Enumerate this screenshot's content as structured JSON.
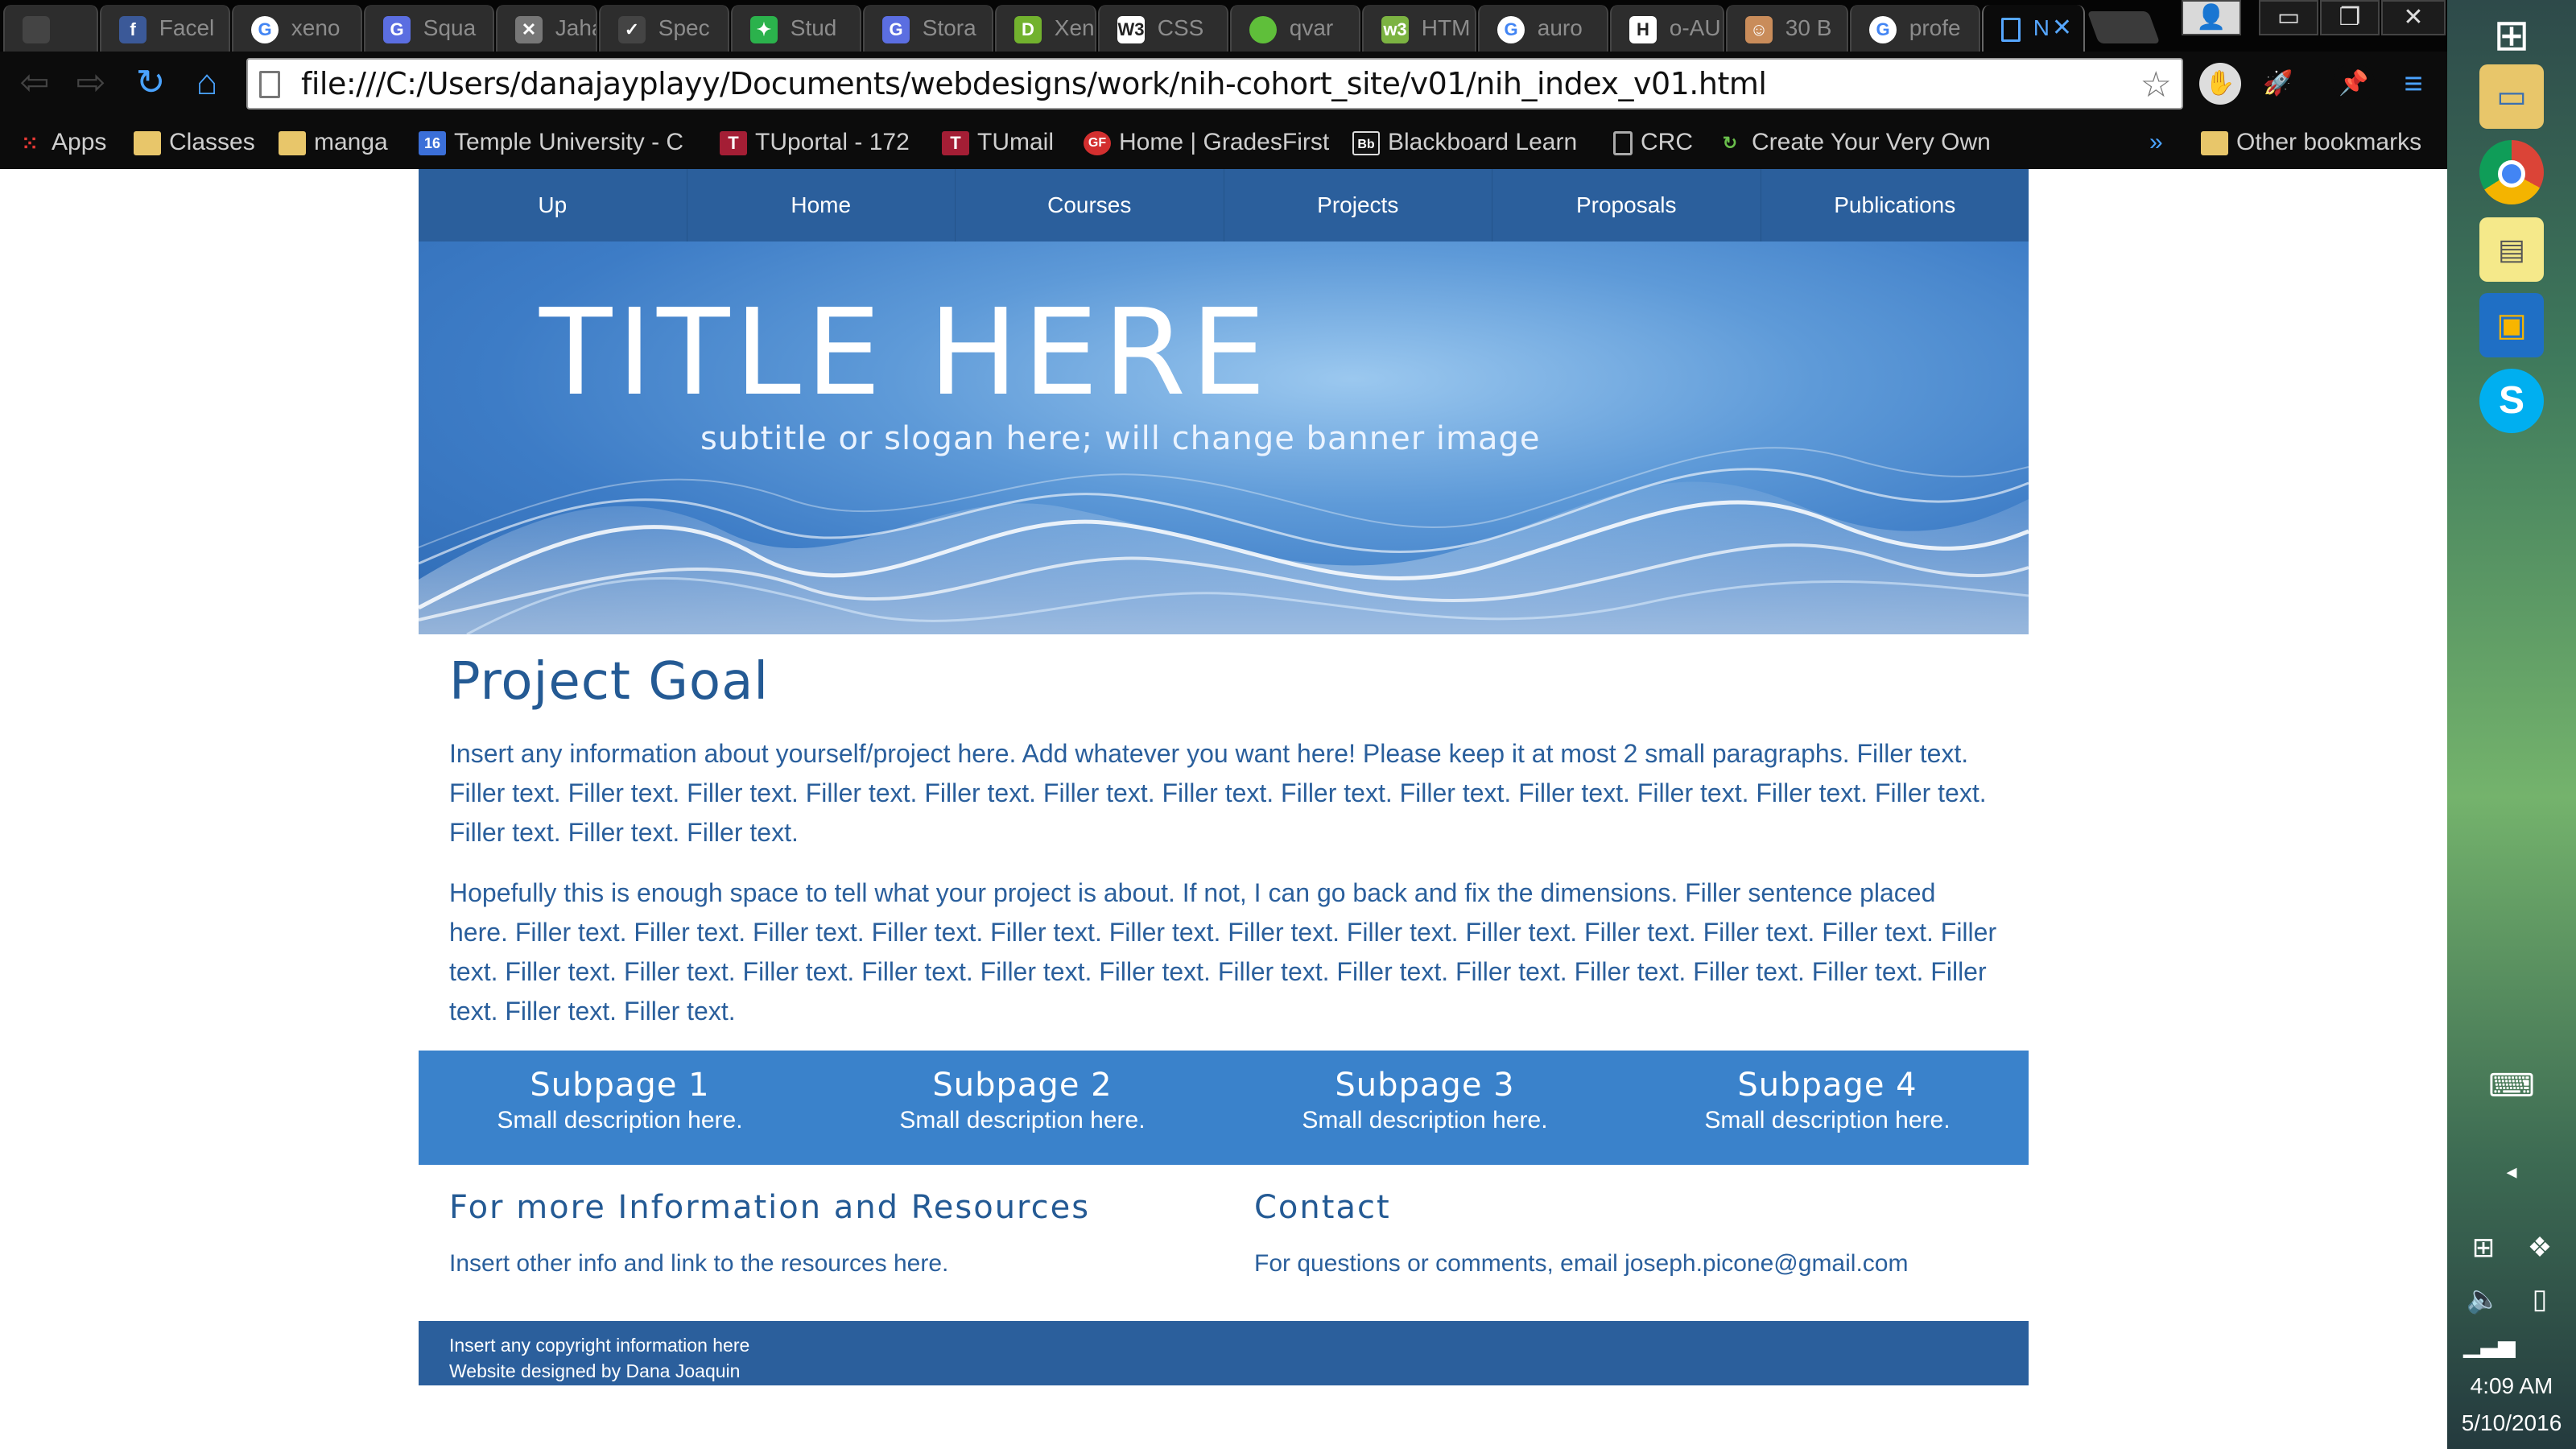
{
  "browser": {
    "tabs": [
      {
        "label": "",
        "icon": "blank-page-icon",
        "color": "#555555"
      },
      {
        "label": "Facel",
        "icon": "facebook-icon",
        "color": "#3b5998"
      },
      {
        "label": "xeno",
        "icon": "google-icon",
        "color": "#4285f4"
      },
      {
        "label": "Squa",
        "icon": "squarespace-icon",
        "color": "#5b6ee1"
      },
      {
        "label": "Jahar",
        "icon": "x-icon",
        "color": "#777777"
      },
      {
        "label": "Spec",
        "icon": "check-icon",
        "color": "#444444"
      },
      {
        "label": "Stud",
        "icon": "puzzle-icon",
        "color": "#2bb24c"
      },
      {
        "label": "Stora",
        "icon": "squarespace-icon",
        "color": "#5b6ee1"
      },
      {
        "label": "Xeno",
        "icon": "d-icon",
        "color": "#72b22e"
      },
      {
        "label": "CSS",
        "icon": "w3-icon",
        "color": "#ffffff"
      },
      {
        "label": "qvar",
        "icon": "circle-icon",
        "color": "#5fbf3a"
      },
      {
        "label": "HTM",
        "icon": "w3-icon",
        "color": "#7cb342"
      },
      {
        "label": "auro",
        "icon": "google-icon",
        "color": "#4285f4"
      },
      {
        "label": "o-AU",
        "icon": "h-icon",
        "color": "#ffffff"
      },
      {
        "label": "30 B",
        "icon": "avatar-icon",
        "color": "#c98c5a"
      },
      {
        "label": "profe",
        "icon": "google-icon",
        "color": "#4285f4"
      },
      {
        "label": "N",
        "icon": "page-icon",
        "color": "#56a7ff"
      }
    ],
    "url": "file:///C:/Users/danajayplayy/Documents/webdesigns/work/nih-cohort_site/v01/nih_index_v01.html",
    "bookmarks": [
      {
        "label": "Apps",
        "icon": "apps-grid-icon"
      },
      {
        "label": "Classes",
        "icon": "folder-icon"
      },
      {
        "label": "manga",
        "icon": "folder-icon"
      },
      {
        "label": "Temple University - C",
        "icon": "calendar-icon"
      },
      {
        "label": "TUportal - 172",
        "icon": "temple-icon"
      },
      {
        "label": "TUmail",
        "icon": "temple-icon"
      },
      {
        "label": "Home | GradesFirst",
        "icon": "gradesfirst-icon"
      },
      {
        "label": "Blackboard Learn",
        "icon": "blackboard-icon"
      },
      {
        "label": "CRC",
        "icon": "page-icon"
      },
      {
        "label": "Create Your Very Own",
        "icon": "refresh-icon"
      }
    ],
    "more_bookmarks": "»",
    "other_bookmarks": "Other bookmarks"
  },
  "site": {
    "nav": [
      "Up",
      "Home",
      "Courses",
      "Projects",
      "Proposals",
      "Publications"
    ],
    "banner": {
      "title": "TITLE HERE",
      "subtitle": "subtitle or slogan here; will change banner image"
    },
    "goal": {
      "heading": "Project Goal",
      "paragraphs": [
        "Insert any information about yourself/project here. Add whatever you want here! Please keep it at most 2 small paragraphs. Filler text. Filler text. Filler text. Filler text. Filler text. Filler text. Filler text. Filler text. Filler text. Filler text. Filler text. Filler text. Filler text. Filler text. Filler text. Filler text. Filler text.",
        "Hopefully this is enough space to tell what your project is about. If not, I can go back and fix the dimensions. Filler sentence placed here. Filler text. Filler text. Filler text. Filler text. Filler text. Filler text. Filler text. Filler text. Filler text. Filler text. Filler text. Filler text. Filler text. Filler text. Filler text. Filler text. Filler text. Filler text. Filler text. Filler text. Filler text. Filler text. Filler text. Filler text. Filler text. Filler text. Filler text. Filler text."
      ]
    },
    "subpages": [
      {
        "title": "Subpage 1",
        "desc": "Small description here."
      },
      {
        "title": "Subpage 2",
        "desc": "Small description here."
      },
      {
        "title": "Subpage 3",
        "desc": "Small description here."
      },
      {
        "title": "Subpage 4",
        "desc": "Small description here."
      }
    ],
    "resources": {
      "heading": "For more Information and Resources",
      "text": "Insert other info and link to the resources here."
    },
    "contact": {
      "heading": "Contact",
      "text": "For questions or comments, email joseph.picone@gmail.com"
    },
    "footer": {
      "line1": "Insert any copyright information here",
      "line2": "Website designed by Dana Joaquin"
    },
    "colors": {
      "nav": "#2b5f9c",
      "subpage_band": "#3a82cb",
      "text": "#2a5f9c"
    }
  },
  "system": {
    "time": "4:09 AM",
    "date": "5/10/2016",
    "taskbar_apps": [
      "windows-start-icon",
      "file-explorer-icon",
      "chrome-icon",
      "sticky-notes-icon",
      "outlook-icon",
      "skype-icon"
    ]
  }
}
